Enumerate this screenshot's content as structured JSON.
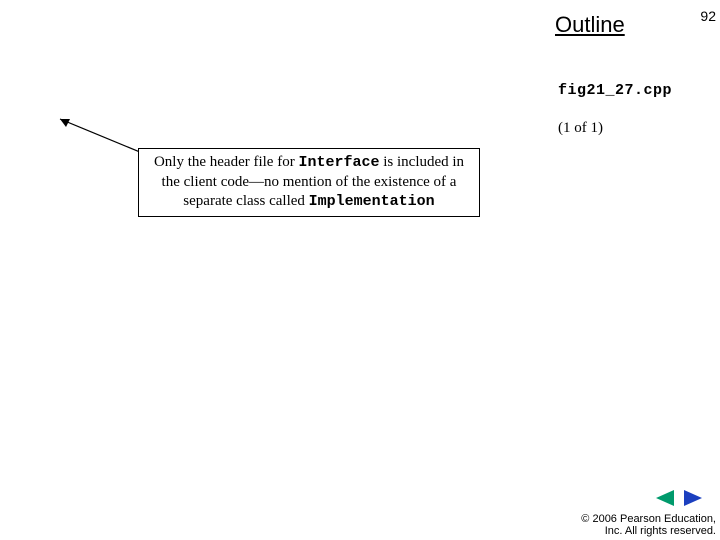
{
  "header": {
    "title": "Outline",
    "page_number": "92"
  },
  "file": {
    "name": "fig21_27.cpp",
    "page_of": "(1 of 1)"
  },
  "callout": {
    "pre1": "Only the header file for ",
    "code1": "Interface",
    "mid1": " is included in",
    "line2": "the client code—no mention of the existence of a",
    "pre3": "separate class called ",
    "code3": "Implementation"
  },
  "footer": {
    "copyright_line1": "© 2006 Pearson Education,",
    "copyright_line2": "Inc.  All rights reserved."
  },
  "nav": {
    "prev_color": "#009a6c",
    "next_color": "#1b3fbf"
  }
}
